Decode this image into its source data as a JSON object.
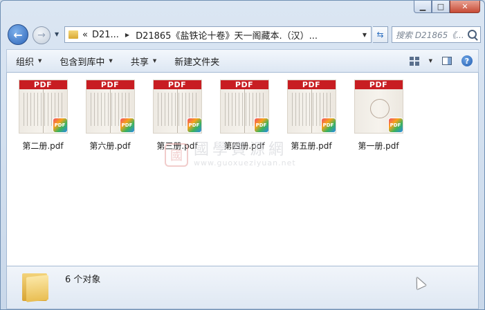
{
  "window": {
    "caption_buttons": {
      "minimize": "▁",
      "maximize": "□",
      "close": "✕"
    }
  },
  "navigation": {
    "back_glyph": "←",
    "forward_glyph": "→",
    "address": {
      "overflow": "«",
      "crumbs": [
        "D21...",
        "D21865《盐铁论十卷》天一阁藏本.（汉）..."
      ]
    },
    "search_placeholder": "搜索 D21865《..."
  },
  "toolbar": {
    "organize": "组织",
    "include_in_library": "包含到库中",
    "share": "共享",
    "new_folder": "新建文件夹",
    "help": "?"
  },
  "files": [
    {
      "name": "第二册.pdf",
      "badge": "PDF",
      "kind": "text"
    },
    {
      "name": "第六册.pdf",
      "badge": "PDF",
      "kind": "text"
    },
    {
      "name": "第三册.pdf",
      "badge": "PDF",
      "kind": "text"
    },
    {
      "name": "第四册.pdf",
      "badge": "PDF",
      "kind": "text"
    },
    {
      "name": "第五册.pdf",
      "badge": "PDF",
      "kind": "text"
    },
    {
      "name": "第一册.pdf",
      "badge": "PDF",
      "kind": "blank"
    }
  ],
  "watermark": {
    "seal": "國",
    "title": "國學資源網",
    "url": "www.guoxueziyuan.net"
  },
  "status": {
    "count": "6 个对象"
  },
  "colors": {
    "pdf_band": "#c81d22",
    "window_frame": "#c9d8ea"
  }
}
